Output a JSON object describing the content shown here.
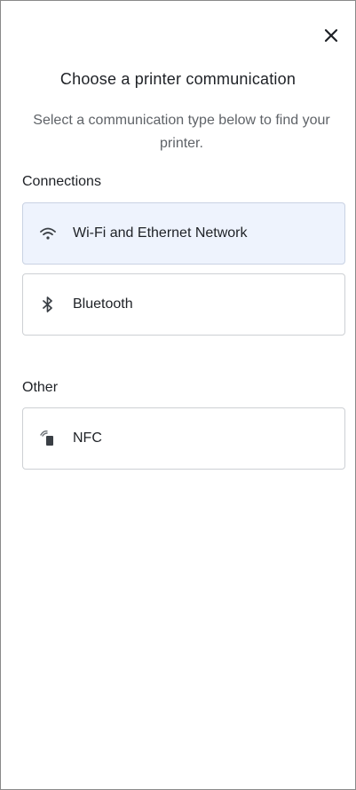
{
  "dialog": {
    "close_icon": "close-icon",
    "title": "Choose a printer communication",
    "subtitle": "Select a communication type below to find your printer."
  },
  "sections": {
    "connections": {
      "label": "Connections",
      "options": [
        {
          "label": "Wi-Fi and Ethernet Network",
          "icon": "wifi-icon",
          "selected": true
        },
        {
          "label": "Bluetooth",
          "icon": "bluetooth-icon",
          "selected": false
        }
      ]
    },
    "other": {
      "label": "Other",
      "options": [
        {
          "label": "NFC",
          "icon": "nfc-icon",
          "selected": false
        }
      ]
    }
  },
  "colors": {
    "selected_background": "#eef3fd",
    "border": "#cdd0d4",
    "text": "#1e2126",
    "muted_text": "#5f6368"
  }
}
